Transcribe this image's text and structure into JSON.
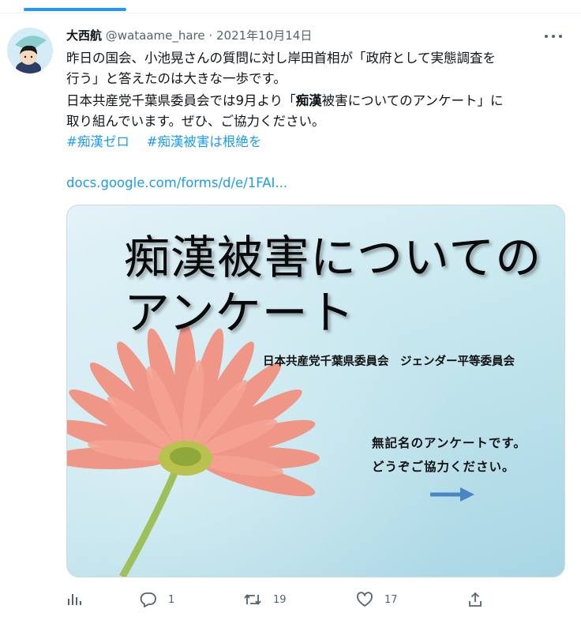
{
  "tweet": {
    "author": {
      "display_name": "大西航",
      "handle": "@wataame_hare"
    },
    "separator": "·",
    "date": "2021年10月14日",
    "lines": [
      "昨日の国会、小池晃さんの質問に対し岸田首相が「政府として実態調査を",
      "行う」と答えたのは大きな一歩です。",
      "日本共産党千葉県委員会では9月より「",
      "痴漢",
      "被害についてのアンケート」に",
      "取り組んでいます。ぜひ、ご協力ください。"
    ],
    "hashtags": [
      "#痴漢ゼロ",
      "#痴漢被害は根絶を"
    ],
    "link": "docs.google.com/forms/d/e/1FAI..."
  },
  "card": {
    "title_line1": "痴漢被害についての",
    "title_line2": "アンケート",
    "org": "日本共産党千葉県委員会　ジェンダー平等委員会",
    "note_line1": "無記名のアンケートです。",
    "note_line2": "どうぞご協力ください。"
  },
  "actions": {
    "analytics_icon": "analytics-icon",
    "reply_icon": "reply-icon",
    "reply_count": "1",
    "retweet_icon": "retweet-icon",
    "retweet_count": "19",
    "like_icon": "heart-icon",
    "like_count": "17",
    "share_icon": "share-icon"
  },
  "colors": {
    "accent": "#1d9bf0",
    "text": "#0f1419",
    "muted": "#536471",
    "flower": "#f28f7e"
  }
}
